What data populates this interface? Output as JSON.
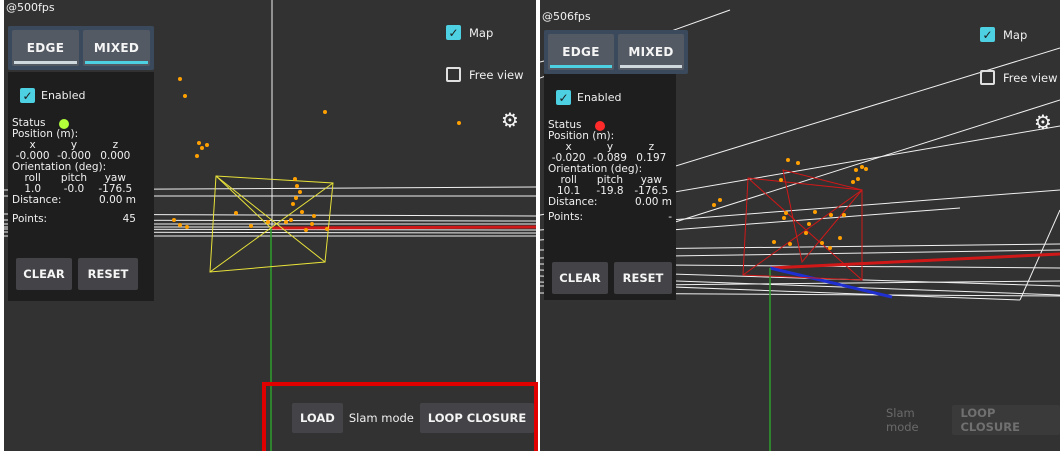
{
  "left": {
    "fps": "@500fps",
    "tabs": {
      "edge": "EDGE",
      "mixed": "MIXED",
      "active": "mixed"
    },
    "enabled_label": "Enabled",
    "enabled": true,
    "status_label": "Status",
    "status_color": "#b2ff3a",
    "position_label": "Position (m):",
    "pos_headers": [
      "x",
      "y",
      "z"
    ],
    "pos_values": [
      "-0.000",
      "-0.000",
      "0.000"
    ],
    "orientation_label": "Orientation (deg):",
    "ori_headers": [
      "roll",
      "pitch",
      "yaw"
    ],
    "ori_values": [
      "1.0",
      "-0.0",
      "-176.5"
    ],
    "distance_label": "Distance:",
    "distance_value": "0.00  m",
    "points_label": "Points:",
    "points_value": "45",
    "clear_label": "CLEAR",
    "reset_label": "RESET",
    "map_label": "Map",
    "map_checked": true,
    "free_view_label": "Free view",
    "free_view_checked": false,
    "gear_icon": "gear-icon",
    "slam": {
      "load_label": "LOAD",
      "mode_label": "Slam mode",
      "mode_value": "LOOP CLOSURE",
      "enabled": true
    }
  },
  "right": {
    "fps": "@506fps",
    "tabs": {
      "edge": "EDGE",
      "mixed": "MIXED",
      "active": "edge"
    },
    "enabled_label": "Enabled",
    "enabled": true,
    "status_label": "Status",
    "status_color": "#ff2a2a",
    "position_label": "Position (m):",
    "pos_headers": [
      "x",
      "y",
      "z"
    ],
    "pos_values": [
      "-0.020",
      "-0.089",
      "0.197"
    ],
    "orientation_label": "Orientation (deg):",
    "ori_headers": [
      "roll",
      "pitch",
      "yaw"
    ],
    "ori_values": [
      "10.1",
      "-19.8",
      "-176.5"
    ],
    "distance_label": "Distance:",
    "distance_value": "0.00  m",
    "points_label": "Points:",
    "points_value": "-",
    "clear_label": "CLEAR",
    "reset_label": "RESET",
    "map_label": "Map",
    "map_checked": true,
    "free_view_label": "Free view",
    "free_view_checked": false,
    "gear_icon": "gear-icon",
    "slam": {
      "mode_label": "Slam mode",
      "mode_value": "LOOP CLOSURE",
      "enabled": false
    }
  },
  "colors": {
    "accent": "#4dd0e1",
    "viewport_bg": "#323232",
    "panel_bg": "#1e1e1e",
    "point_color": "#ffa000",
    "frustum_left": "#e8e23a",
    "frustum_right": "#d01818",
    "axis_x": "#d01818",
    "axis_y": "#2e9e2e",
    "axis_z": "#2030d0",
    "highlight": "#e00000"
  }
}
